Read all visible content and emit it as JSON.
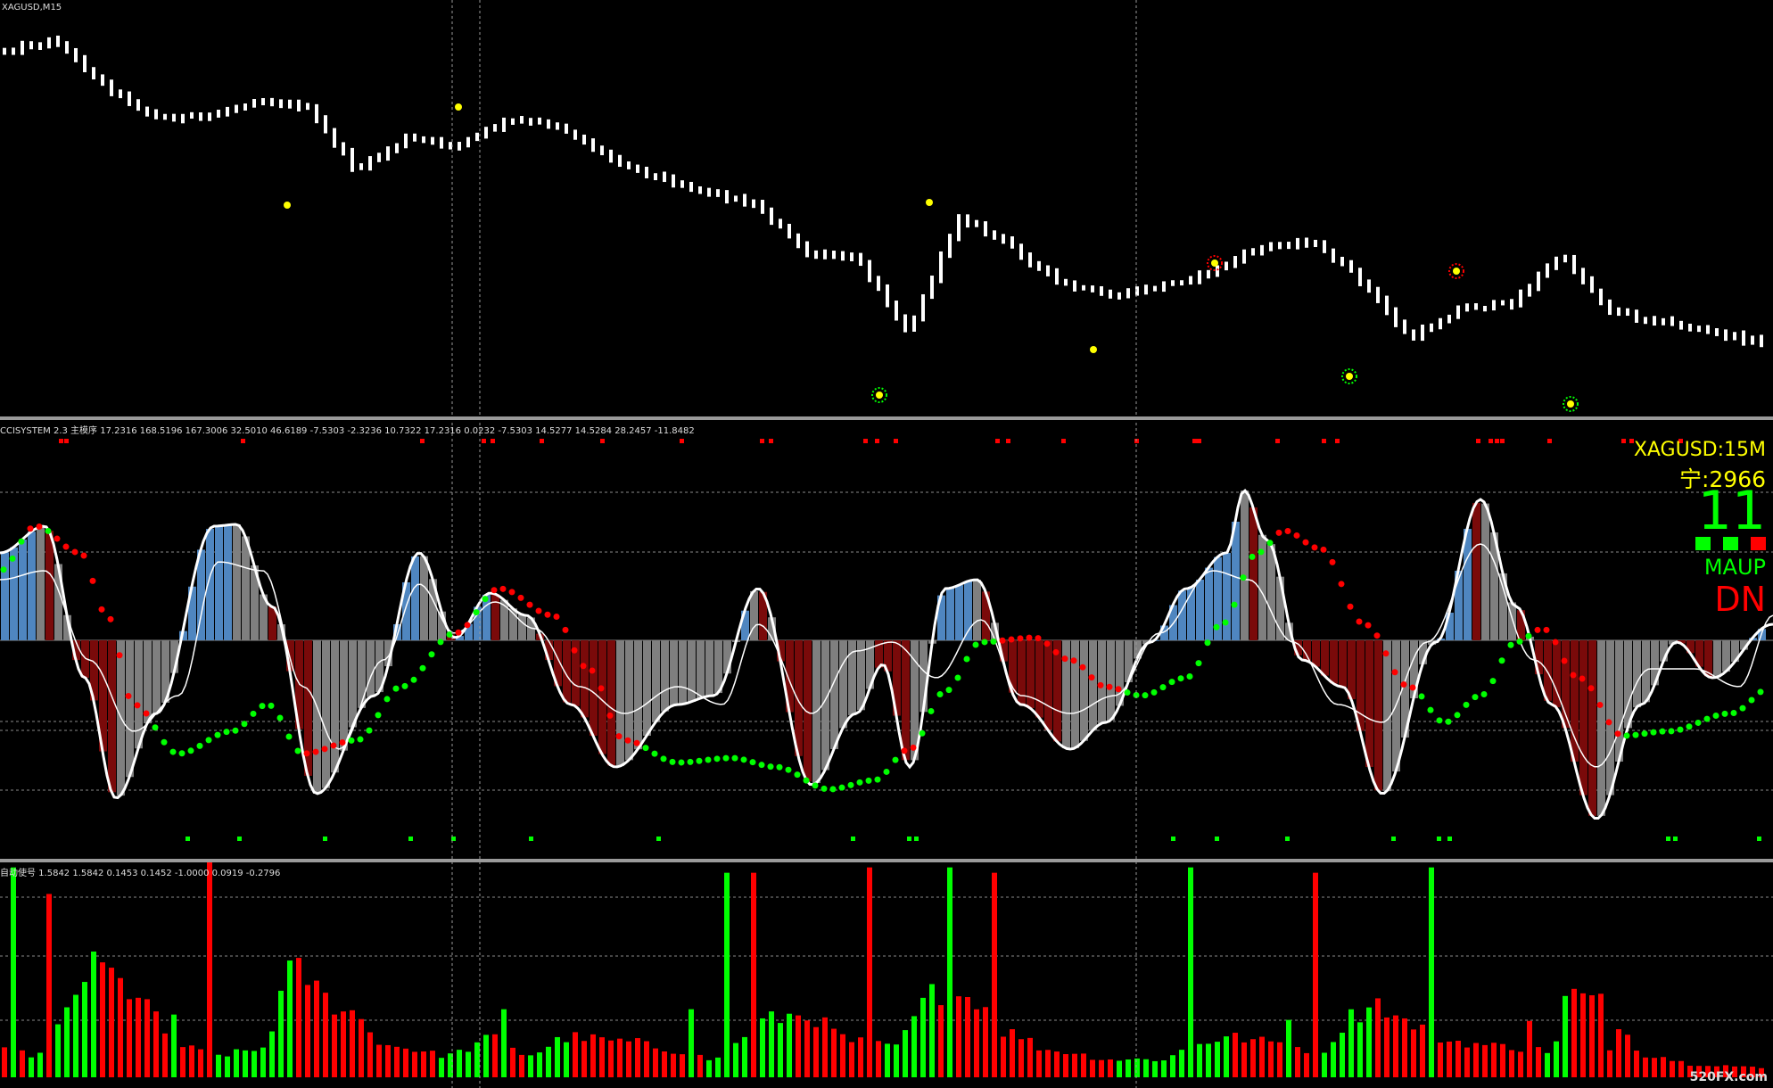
{
  "main_panel": {
    "symbol_label": "XAGUSD,M15",
    "bar_color": "#ffffff",
    "marker_color_yellow": "#ffff00",
    "marker_color_red": "#ff0000",
    "marker_color_green": "#00ff00"
  },
  "cci_panel": {
    "header": "CCISYSTEM 2.3 主模序 17.2316 168.5196 167.3006 32.5010 46.6189 -7.5303 -2.3236 10.7322 17.2316 0.0232 -7.5303 14.5277 14.5284 28.2457 -11.8482",
    "info": {
      "symbol": "XAGUSD:15M",
      "count": "宁:2966",
      "big_number": "11",
      "square_colors": [
        "#00ff00",
        "#00ff00",
        "#ff0000"
      ],
      "trend1": "MAUP",
      "trend2": "DN"
    },
    "colors": {
      "blue": "#4f86c0",
      "red": "#7a0a0a",
      "gray": "#7f7f7f",
      "green_dot": "#00ff00",
      "red_dot": "#ff0000"
    }
  },
  "volume_panel": {
    "header": "自动使号 1.5842 1.5842 0.1453 0.1452 -1.0000 0.0919 -0.2796",
    "green": "#00ff00",
    "red": "#ff0000"
  },
  "watermark": "520FX.com",
  "chart_data": {
    "type": "line",
    "title": "XAGUSD,M15",
    "series": [
      {
        "name": "XAGUSD,M15",
        "approx_close_profile": [
          0.92,
          0.95,
          0.82,
          0.73,
          0.73,
          0.78,
          0.76,
          0.58,
          0.67,
          0.65,
          0.72,
          0.71,
          0.62,
          0.56,
          0.52,
          0.48,
          0.34,
          0.33,
          0.12,
          0.45,
          0.37,
          0.26,
          0.22,
          0.25,
          0.29,
          0.36,
          0.38,
          0.27,
          0.1,
          0.19,
          0.2,
          0.34,
          0.18,
          0.15,
          0.12,
          0.09
        ]
      }
    ],
    "cci_header_values": [
      17.2316,
      168.5196,
      167.3006,
      32.501,
      46.6189,
      -7.5303,
      -2.3236,
      10.7322,
      17.2316,
      0.0232,
      -7.5303,
      14.5277,
      14.5284,
      28.2457,
      -11.8482
    ],
    "volume_header_values": [
      1.5842,
      1.5842,
      0.1453,
      0.1452,
      -1.0,
      0.0919,
      -0.2796
    ],
    "grid": true
  }
}
